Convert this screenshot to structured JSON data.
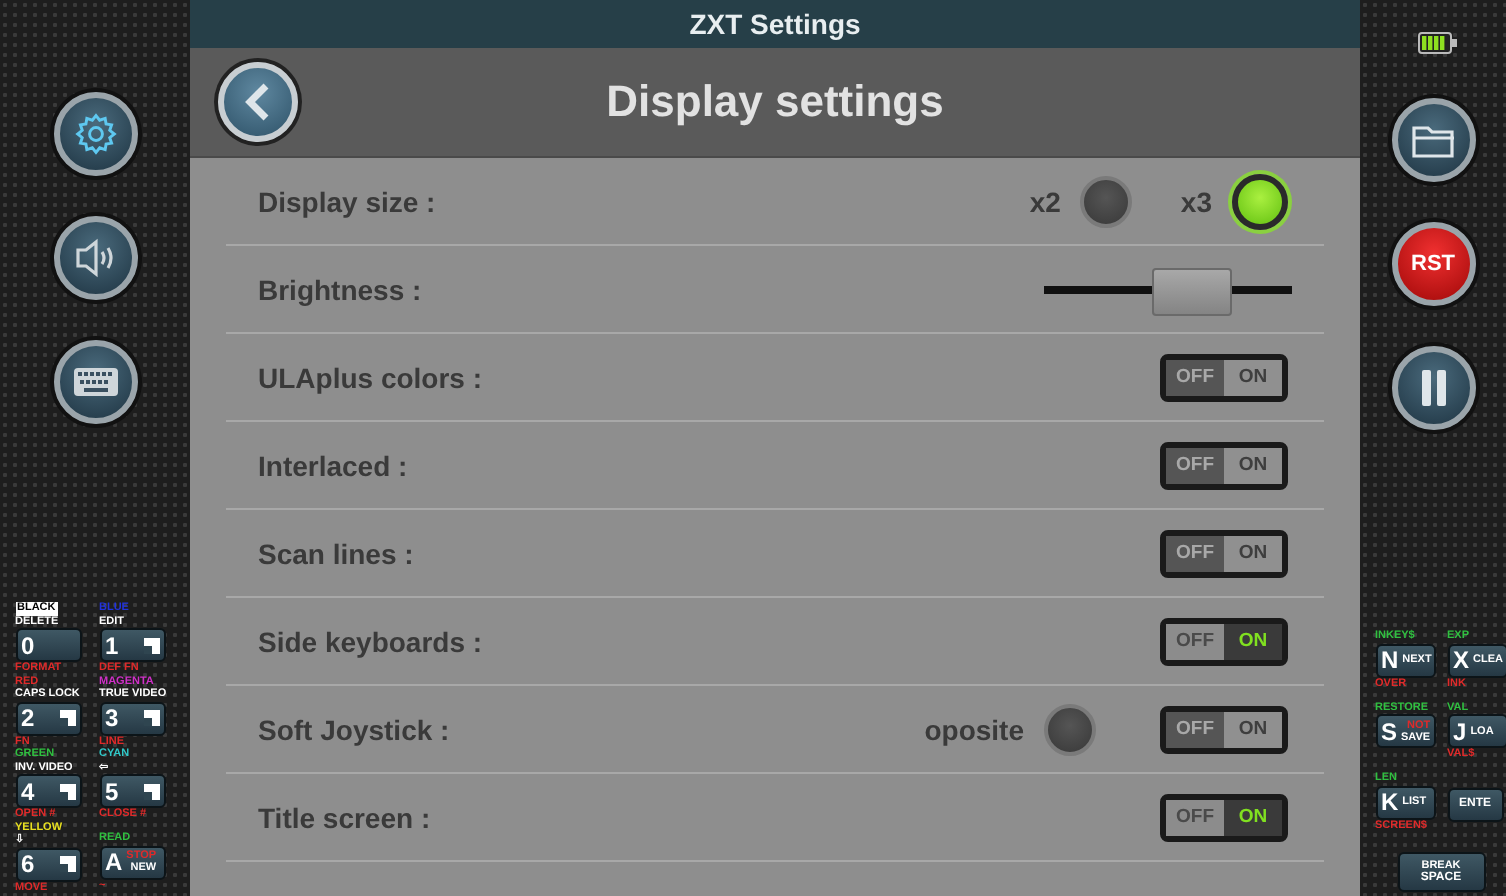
{
  "title_bar": {
    "title": "ZXT Settings"
  },
  "header": {
    "title": "Display settings"
  },
  "right_rail": {
    "reset_button": "RST"
  },
  "settings": [
    {
      "kind": "radio_pair",
      "label": "Display size :",
      "options": [
        {
          "label": "x2",
          "selected": false
        },
        {
          "label": "x3",
          "selected": true
        }
      ]
    },
    {
      "kind": "slider",
      "label": "Brightness :",
      "level": 0.59
    },
    {
      "kind": "toggle",
      "label": "ULAplus colors :",
      "on": false,
      "off_text": "OFF",
      "on_text": "ON"
    },
    {
      "kind": "toggle",
      "label": "Interlaced :",
      "on": false,
      "off_text": "OFF",
      "on_text": "ON"
    },
    {
      "kind": "toggle",
      "label": "Scan lines :",
      "on": false,
      "off_text": "OFF",
      "on_text": "ON"
    },
    {
      "kind": "toggle",
      "label": "Side keyboards :",
      "on": true,
      "off_text": "OFF",
      "on_text": "ON"
    },
    {
      "kind": "toggle_radio",
      "label": "Soft Joystick :",
      "radio": {
        "label": "oposite",
        "checked": false
      },
      "on": false,
      "off_text": "OFF",
      "on_text": "ON"
    },
    {
      "kind": "toggle",
      "label": "Title screen :",
      "on": true,
      "off_text": "OFF",
      "on_text": "ON"
    }
  ],
  "left_keyboard": [
    {
      "kind": "digit",
      "key": "0",
      "above": [
        {
          "text": "BLACK",
          "color": "#000000",
          "inverse": true
        },
        {
          "text": "DELETE",
          "color": "#ffffff",
          "inverse": false
        }
      ],
      "below": "FORMAT"
    },
    {
      "kind": "graphic_digit",
      "key": "1",
      "above": [
        {
          "text": "BLUE",
          "color": "#2233dd",
          "inverse": false
        },
        {
          "text": "EDIT",
          "color": "#ffffff",
          "inverse": false
        }
      ],
      "below": "DEF FN"
    },
    {
      "kind": "graphic_digit",
      "key": "2",
      "above": [
        {
          "text": "RED",
          "color": "#e02a2a",
          "inverse": false
        },
        {
          "text": "CAPS LOCK",
          "color": "#ffffff",
          "inverse": false
        }
      ],
      "below": "FN"
    },
    {
      "kind": "graphic_digit",
      "key": "3",
      "above": [
        {
          "text": "MAGENTA",
          "color": "#d030c8",
          "inverse": false
        },
        {
          "text": "TRUE VIDEO",
          "color": "#ffffff",
          "inverse": false
        }
      ],
      "below": "LINE"
    },
    {
      "kind": "graphic_digit",
      "key": "4",
      "above": [
        {
          "text": "GREEN",
          "color": "#30c040",
          "inverse": false
        },
        {
          "text": "INV. VIDEO",
          "color": "#ffffff",
          "inverse": false
        }
      ],
      "below": "OPEN #"
    },
    {
      "kind": "graphic_digit",
      "key": "5",
      "above": [
        {
          "text": "CYAN",
          "color": "#30c8c8",
          "inverse": false
        },
        {
          "text": "⇦",
          "color": "#ffffff",
          "inverse": false
        }
      ],
      "below": "CLOSE #"
    },
    {
      "kind": "graphic_digit",
      "key": "6",
      "above": [
        {
          "text": "YELLOW",
          "color": "#e8e020",
          "inverse": false
        },
        {
          "text": "⇩",
          "color": "#ffffff",
          "inverse": false
        }
      ],
      "below": "MOVE"
    },
    {
      "kind": "letter",
      "key": "A",
      "above": [
        {
          "text": "READ",
          "color": "#30c040",
          "inverse": false
        }
      ],
      "inner": [
        {
          "text": "STOP",
          "color": "#e02a2a"
        },
        {
          "text": "NEW",
          "color": "#ffffff"
        }
      ],
      "below": "~"
    }
  ],
  "right_keyboard": [
    {
      "kind": "letter",
      "key": "N",
      "above": [
        {
          "text": "INKEY$",
          "color": "#30c040",
          "inverse": false
        }
      ],
      "inner": [
        {
          "text": "NEXT",
          "color": "#ffffff"
        }
      ],
      "below": "OVER"
    },
    {
      "kind": "letter",
      "key": "X",
      "above": [
        {
          "text": "EXP",
          "color": "#30c040",
          "inverse": false
        }
      ],
      "inner": [
        {
          "text": "CLEA",
          "color": "#ffffff"
        }
      ],
      "below": "INK"
    },
    {
      "kind": "letter",
      "key": "S",
      "above": [
        {
          "text": "RESTORE",
          "color": "#30c040",
          "inverse": false
        }
      ],
      "inner": [
        {
          "text": "NOT",
          "color": "#e02a2a"
        },
        {
          "text": "SAVE",
          "color": "#ffffff"
        }
      ]
    },
    {
      "kind": "letter",
      "key": "J",
      "above": [
        {
          "text": "VAL",
          "color": "#30c040",
          "inverse": false
        }
      ],
      "inner": [
        {
          "text": "LOA",
          "color": "#ffffff"
        }
      ],
      "below": "VAL$"
    },
    {
      "kind": "letter",
      "key": "K",
      "above": [
        {
          "text": "LEN",
          "color": "#30c040",
          "inverse": false
        }
      ],
      "inner": [
        {
          "text": "LIST",
          "color": "#ffffff"
        }
      ],
      "below": "SCREEN$"
    },
    {
      "kind": "word",
      "key": "ENTE"
    },
    {
      "kind": "space",
      "key": "SPACE",
      "inner": [
        {
          "text": "BREAK",
          "color": "#ffffff"
        }
      ]
    }
  ]
}
